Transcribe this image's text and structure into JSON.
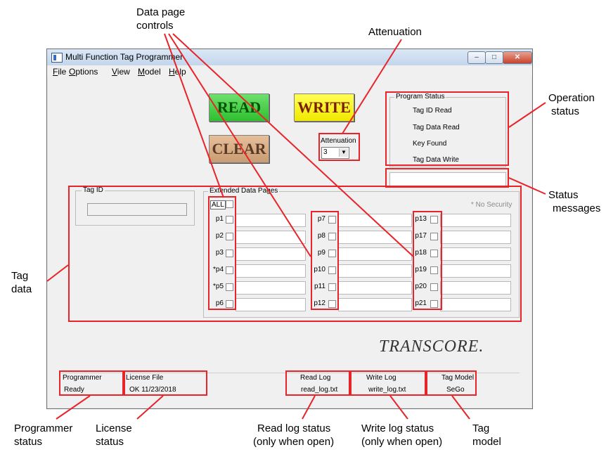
{
  "window": {
    "title": "Multi Function Tag Programmer",
    "controls": {
      "minimize": "–",
      "maximize": "□",
      "close": "✕"
    }
  },
  "menu": [
    {
      "label": "File",
      "u": "F",
      "rest": "ile"
    },
    {
      "label": "Options",
      "u": "O",
      "rest": "ptions"
    },
    {
      "label": "View",
      "u": "V",
      "rest": "iew"
    },
    {
      "label": "Model",
      "u": "M",
      "rest": "odel"
    },
    {
      "label": "Help",
      "u": "H",
      "rest": "elp"
    }
  ],
  "buttons": {
    "read": "READ",
    "write": "WRITE",
    "clear": "CLEAR"
  },
  "attenuation": {
    "label": "Attenuation",
    "value": "3"
  },
  "program_status": {
    "legend": "Program Status",
    "items": [
      "Tag ID Read",
      "Tag Data Read",
      "Key Found",
      "Tag Data Write"
    ]
  },
  "tag_id": {
    "legend": "Tag ID",
    "value": ""
  },
  "extended": {
    "legend": "Extended Data Pages",
    "all_label": "ALL",
    "note": "* No Security",
    "col1": [
      "p1",
      "p2",
      "p3",
      "*p4",
      "*p5",
      "p6"
    ],
    "col2": [
      "p7",
      "p8",
      "p9",
      "p10",
      "p11",
      "p12"
    ],
    "col3": [
      "p13",
      "p17",
      "p18",
      "p19",
      "p20",
      "p21"
    ]
  },
  "logo": {
    "text": "TRANSCORE."
  },
  "statusbar": {
    "programmer": {
      "header": "Programmer",
      "value": "Ready"
    },
    "license": {
      "header": "License File",
      "value": "OK 11/23/2018"
    },
    "readlog": {
      "header": "Read Log",
      "value": "read_log.txt"
    },
    "writelog": {
      "header": "Write Log",
      "value": "write_log.txt"
    },
    "tagmodel": {
      "header": "Tag Model",
      "value": "SeGo"
    }
  },
  "annotations": {
    "data_page_controls": [
      "Data page",
      "controls"
    ],
    "attenuation": "Attenuation",
    "operation_status": [
      "Operation",
      "status"
    ],
    "status_messages": [
      "Status",
      "messages"
    ],
    "tag_data": [
      "Tag",
      "data"
    ],
    "programmer_status": [
      "Programmer",
      "status"
    ],
    "license_status": [
      "License",
      "status"
    ],
    "read_log_status": [
      "Read log status",
      "(only when open)"
    ],
    "write_log_status": [
      "Write log status",
      "(only when open)"
    ],
    "tag_model": [
      "Tag",
      "model"
    ]
  },
  "colors": {
    "highlight": "#e8242a",
    "read": "#2fbf2f",
    "write": "#f0e800",
    "clear": "#c99c72"
  }
}
